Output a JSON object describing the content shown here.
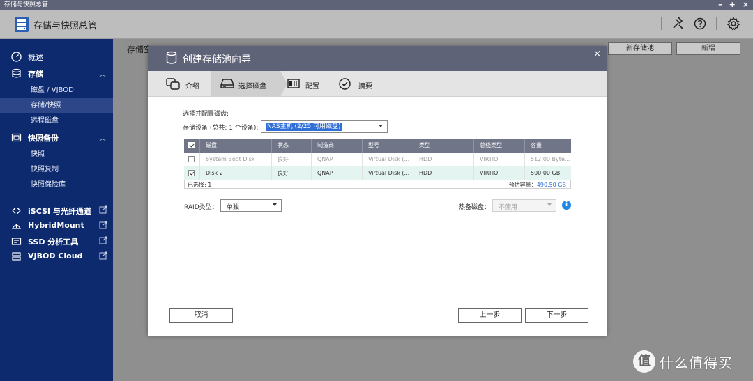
{
  "window": {
    "title": "存储与快照总管",
    "min": "–",
    "max": "+",
    "close": "×"
  },
  "header": {
    "title": "存储与快照总管"
  },
  "sidebar": {
    "overview": "概述",
    "storage": {
      "label": "存储",
      "items": [
        "磁盘 / VJBOD",
        "存储/快照",
        "远程磁盘"
      ]
    },
    "snapshot_backup": {
      "label": "快照备份",
      "items": [
        "快照",
        "快照复制",
        "快照保险库"
      ]
    },
    "links": [
      "iSCSI 与光纤通道",
      "HybridMount",
      "SSD 分析工具",
      "VJBOD Cloud"
    ]
  },
  "main": {
    "label": "存储空",
    "btn_new_pool": "新存储池",
    "btn_new": "新增"
  },
  "dialog": {
    "title": "创建存储池向导",
    "close": "×",
    "steps": [
      "介绍",
      "选择磁盘",
      "配置",
      "摘要"
    ],
    "section_title": "选择并配置磁盘:",
    "device_label": "存储设备 (总共: 1 个设备):",
    "device_value": "NAS主机 (2/25 可用磁盘)",
    "table": {
      "headers": [
        "磁盘",
        "状态",
        "制造商",
        "型号",
        "类型",
        "总线类型",
        "容量"
      ],
      "rows": [
        {
          "disk": "System Boot Disk",
          "status": "良好",
          "vendor": "QNAP",
          "model": "Virtual Disk (...",
          "type": "HDD",
          "bus": "VIRTIO",
          "capacity": "512.00 Byte..."
        },
        {
          "disk": "Disk 2",
          "status": "良好",
          "vendor": "QNAP",
          "model": "Virtual Disk (...",
          "type": "HDD",
          "bus": "VIRTIO",
          "capacity": "500.00 GB"
        }
      ],
      "selected": "已选择: 1",
      "capacity_label": "预估容量：",
      "capacity_value": "490.50 GB"
    },
    "raid_label": "RAID类型：",
    "raid_value": "单独",
    "spare_label": "热备磁盘：",
    "spare_value": "不使用",
    "info": "i",
    "btn_cancel": "取消",
    "btn_prev": "上一步",
    "btn_next": "下一步"
  },
  "watermark": {
    "logo": "值",
    "text": "什么值得买"
  }
}
